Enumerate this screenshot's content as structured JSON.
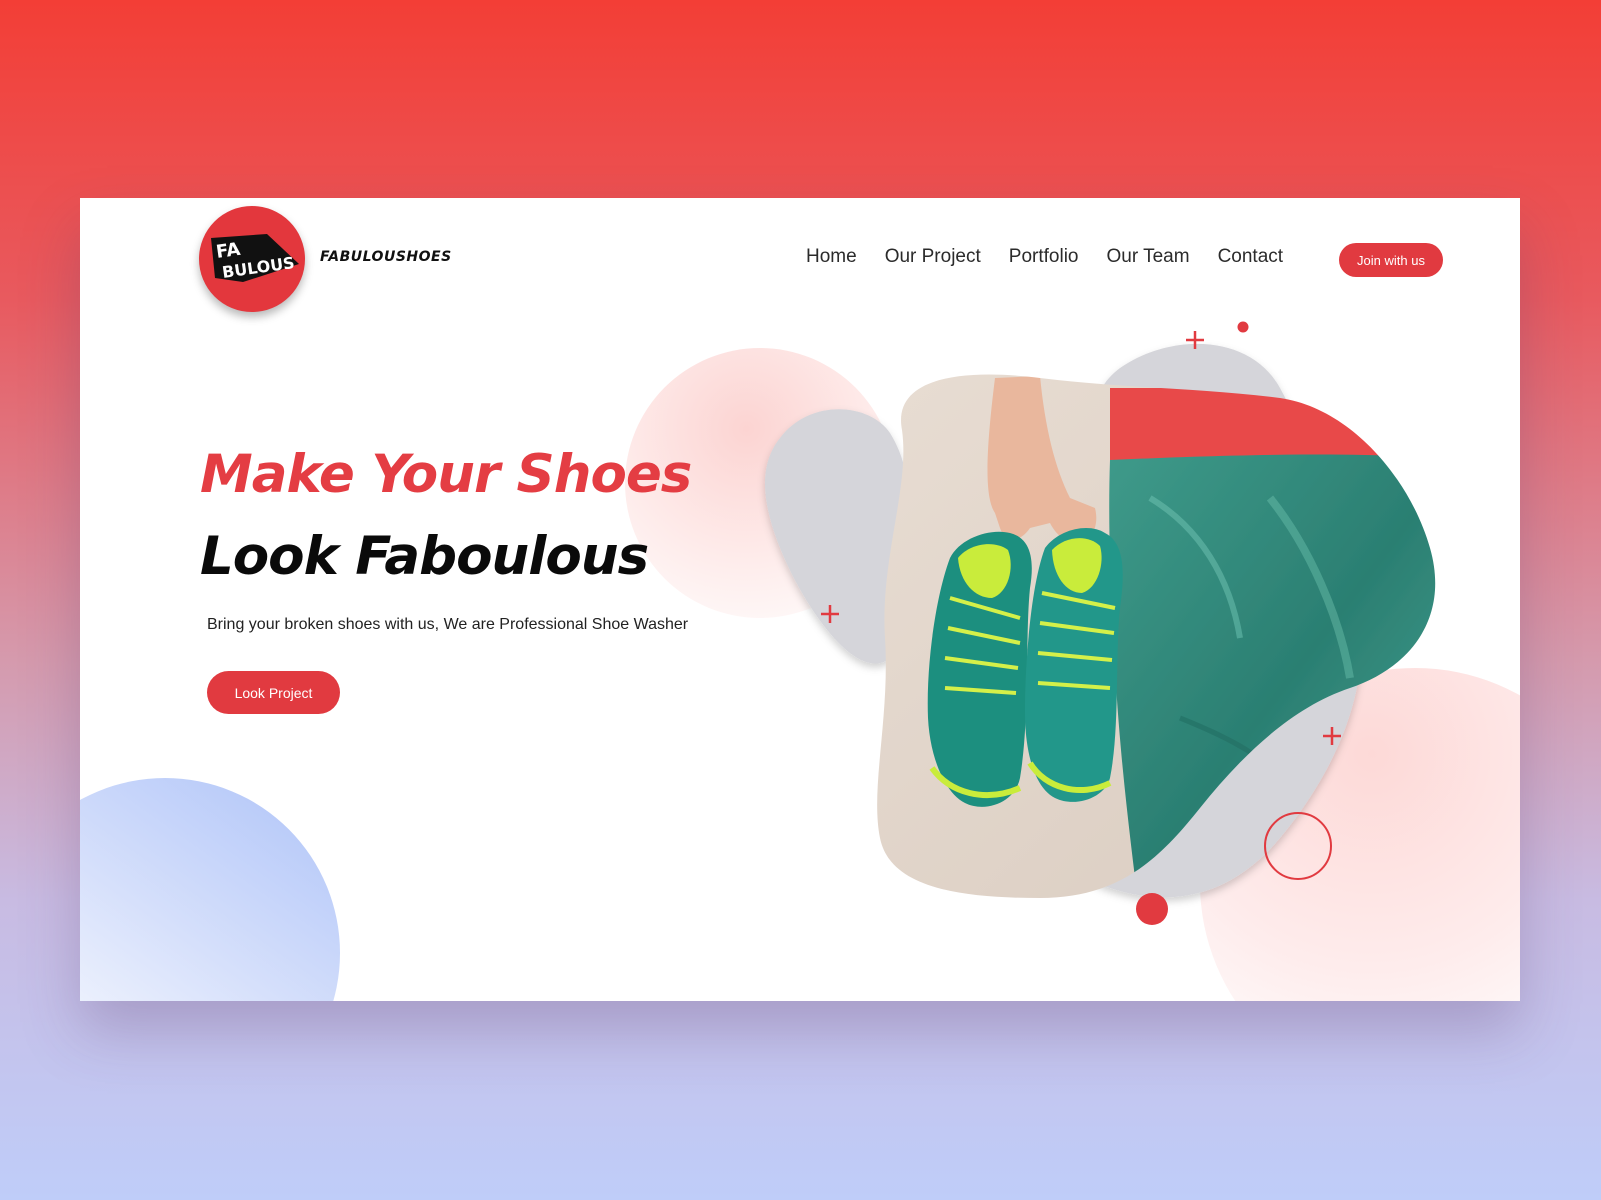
{
  "brand": {
    "name": "FABULOUSHOES",
    "logo_text": "FABULOUS"
  },
  "nav": {
    "items": [
      {
        "label": "Home"
      },
      {
        "label": "Our Project"
      },
      {
        "label": "Portfolio"
      },
      {
        "label": "Our Team"
      },
      {
        "label": "Contact"
      }
    ],
    "cta_label": "Join with us"
  },
  "hero": {
    "title_line_1": "Make Your Shoes",
    "title_line_2": "Look Faboulous",
    "subtitle": "Bring your broken shoes with us, We are Professional Shoe Washer",
    "cta_label": "Look Project",
    "image_icon": "photo-of-sneakers-held-by-hand"
  },
  "colors": {
    "accent": "#e13a40",
    "background_top": "#f33e36",
    "background_bottom": "#bfcdf9",
    "blob_gray": "#d5d5da",
    "decor_blue": "#aec3f8"
  }
}
